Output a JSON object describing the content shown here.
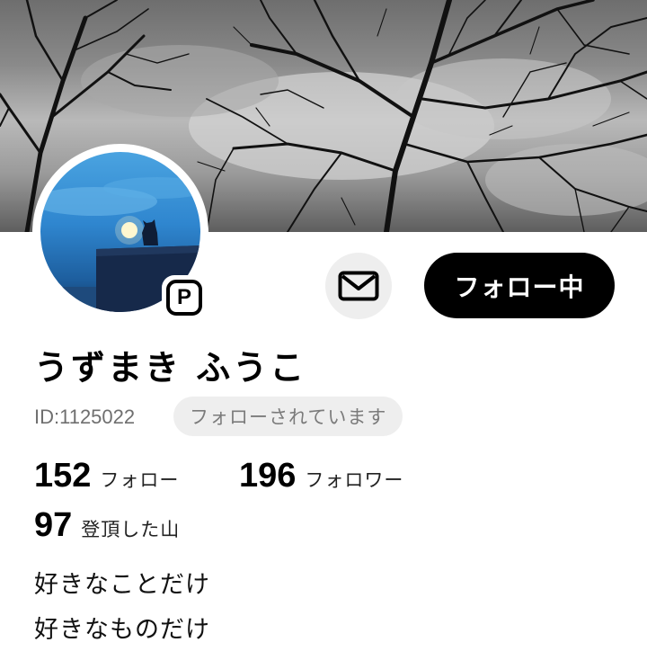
{
  "profile": {
    "display_name": "うずまき ふうこ",
    "user_id": "ID:1125022",
    "follows_you_badge": "フォローされています",
    "premium_badge": "P",
    "follow_button_label": "フォロー中",
    "message_icon": "envelope-icon",
    "stats": {
      "following_count": "152",
      "following_label": "フォロー",
      "followers_count": "196",
      "followers_label": "フォロワー",
      "peaks_count": "97",
      "peaks_label": "登頂した山"
    },
    "bio": [
      "好きなことだけ",
      "好きなものだけ"
    ]
  },
  "colors": {
    "follow_button_bg": "#000000",
    "follow_button_text": "#ffffff",
    "pill_bg": "#eeeeee",
    "muted_text": "#6f6f6f"
  }
}
